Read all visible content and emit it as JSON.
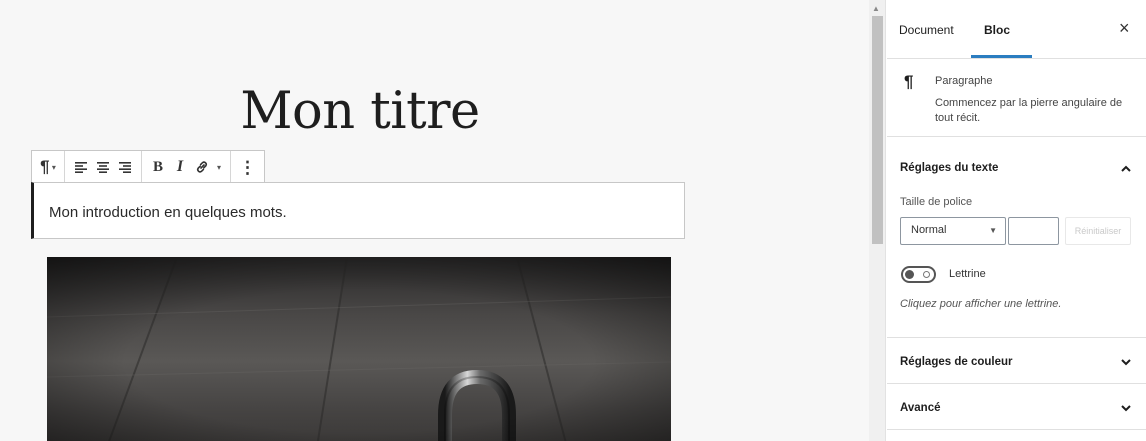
{
  "editor": {
    "post_title": "Mon titre",
    "paragraph_text": "Mon introduction en quelques mots.",
    "toolbar": {
      "block_type_icon": "¶",
      "bold_label": "B",
      "italic_label": "I",
      "more_icon": "⋮",
      "icons": [
        "pilcrow-icon",
        "align-left-icon",
        "align-center-icon",
        "align-right-icon",
        "bold-icon",
        "italic-icon",
        "link-icon",
        "more-options-icon"
      ]
    }
  },
  "sidebar": {
    "tabs": [
      {
        "label": "Document",
        "active": false
      },
      {
        "label": "Bloc",
        "active": true
      }
    ],
    "close_icon": "×",
    "block": {
      "icon": "¶",
      "name": "Paragraphe",
      "description": "Commencez par la pierre angulaire de tout récit."
    },
    "text_settings": {
      "title": "Réglages du texte",
      "expanded": true,
      "font_size_label": "Taille de police",
      "font_size_value": "Normal",
      "custom_size_value": "",
      "reset_label": "Réinitialiser",
      "drop_cap_label": "Lettrine",
      "drop_cap_enabled": false,
      "drop_cap_help": "Cliquez pour afficher une lettrine."
    },
    "color_settings": {
      "title": "Réglages de couleur",
      "expanded": false
    },
    "advanced": {
      "title": "Avancé",
      "expanded": false
    }
  },
  "colors": {
    "accent": "#2b7dc0",
    "text": "#1e1e1e",
    "canvas_bg": "#f7f7f7"
  }
}
